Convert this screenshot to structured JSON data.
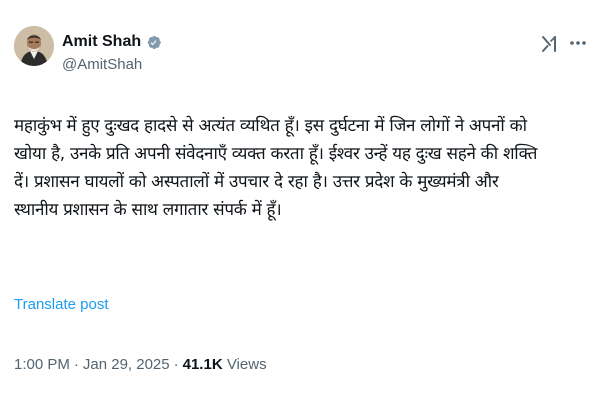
{
  "author": {
    "name": "Amit Shah",
    "handle": "@AmitShah",
    "verified": true
  },
  "icons": {
    "verified": "verified-badge-icon",
    "grok": "grok-icon",
    "more": "more-options-icon"
  },
  "post": {
    "text": "महाकुंभ में हुए दुःखद हादसे से अत्यंत व्यथित हूँ। इस दुर्घटना में जिन लोगों ने अपनों को\nखोया है, उनके प्रति अपनी संवेदनाएँ व्यक्त करता हूँ। ईश्वर उन्हें यह दुःख सहने की शक्ति\nदें। प्रशासन घायलों को अस्पतालों में उपचार दे रहा है। उत्तर प्रदेश के मुख्यमंत्री और\nस्थानीय प्रशासन के साथ लगातार संपर्क में हूँ।",
    "translate_label": "Translate post",
    "time": "1:00 PM",
    "separator": "·",
    "date": "Jan 29, 2025",
    "views_count": "41.1K",
    "views_label": "Views"
  },
  "colors": {
    "accent": "#1d9bf0",
    "secondary_text": "#536471",
    "primary_text": "#0f1419"
  }
}
